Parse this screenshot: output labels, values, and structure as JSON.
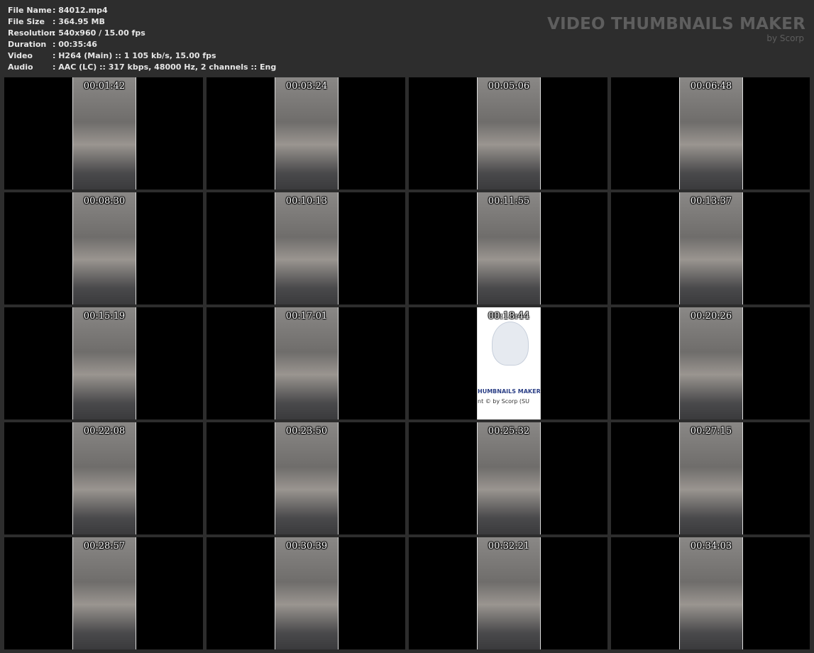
{
  "info": [
    {
      "label": "File Name",
      "value": ": 84012.mp4"
    },
    {
      "label": "File Size",
      "value": ": 364.95 MB"
    },
    {
      "label": "Resolution",
      "value": ": 540x960 / 15.00 fps"
    },
    {
      "label": "Duration",
      "value": ": 00:35:46"
    },
    {
      "label": "Video",
      "value": ": H264 (Main) :: 1 105 kb/s, 15.00 fps"
    },
    {
      "label": "Audio",
      "value": ": AAC (LC) :: 317 kbps, 48000 Hz, 2 channels :: Eng"
    }
  ],
  "brand": {
    "title": "VIDEO THUMBNAILS MAKER",
    "subtitle": "by Scorp"
  },
  "thumbnails": [
    {
      "time": "00:01:42"
    },
    {
      "time": "00:03:24"
    },
    {
      "time": "00:05:06"
    },
    {
      "time": "00:06:48"
    },
    {
      "time": "00:08:30"
    },
    {
      "time": "00:10:13"
    },
    {
      "time": "00:11:55"
    },
    {
      "time": "00:13:37"
    },
    {
      "time": "00:15:19"
    },
    {
      "time": "00:17:01"
    },
    {
      "time": "00:18:44",
      "logo_line1": "HUMBNAILS MAKER",
      "logo_line2": "nt © by Scorp (SU"
    },
    {
      "time": "00:20:26"
    },
    {
      "time": "00:22:08"
    },
    {
      "time": "00:23:50"
    },
    {
      "time": "00:25:32"
    },
    {
      "time": "00:27:15"
    },
    {
      "time": "00:28:57"
    },
    {
      "time": "00:30:39"
    },
    {
      "time": "00:32:21"
    },
    {
      "time": "00:34:03"
    }
  ]
}
